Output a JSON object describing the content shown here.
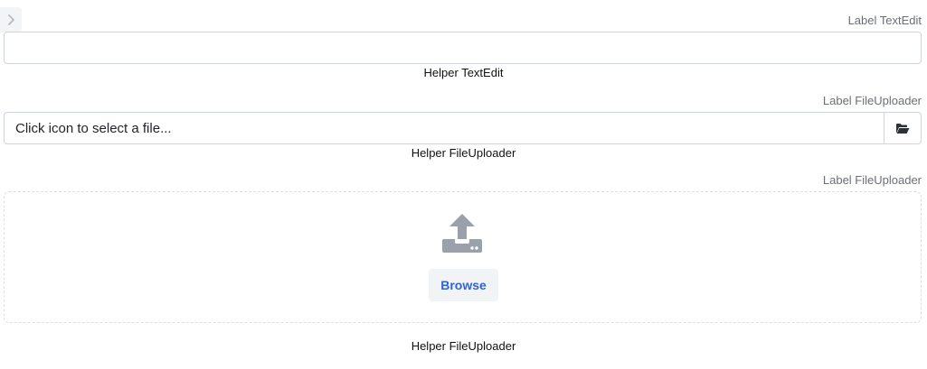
{
  "sidebar_toggle": {
    "icon": "chevron-right-icon"
  },
  "text_edit": {
    "label": "Label TextEdit",
    "value": "",
    "placeholder": "",
    "helper": "Helper TextEdit"
  },
  "file_uploader_input": {
    "label": "Label FileUploader",
    "placeholder": "Click icon to select a file...",
    "button_icon": "folder-open-icon",
    "helper": "Helper FileUploader"
  },
  "file_uploader_dropzone": {
    "label": "Label FileUploader",
    "icon": "upload-icon",
    "browse_label": "Browse",
    "helper": "Helper FileUploader"
  },
  "colors": {
    "label_text": "#6b6f76",
    "border": "#ced4da",
    "browse_text": "#2f63d9",
    "browse_bg": "#f1f3f5",
    "icon_gray": "#9aa1ab"
  }
}
